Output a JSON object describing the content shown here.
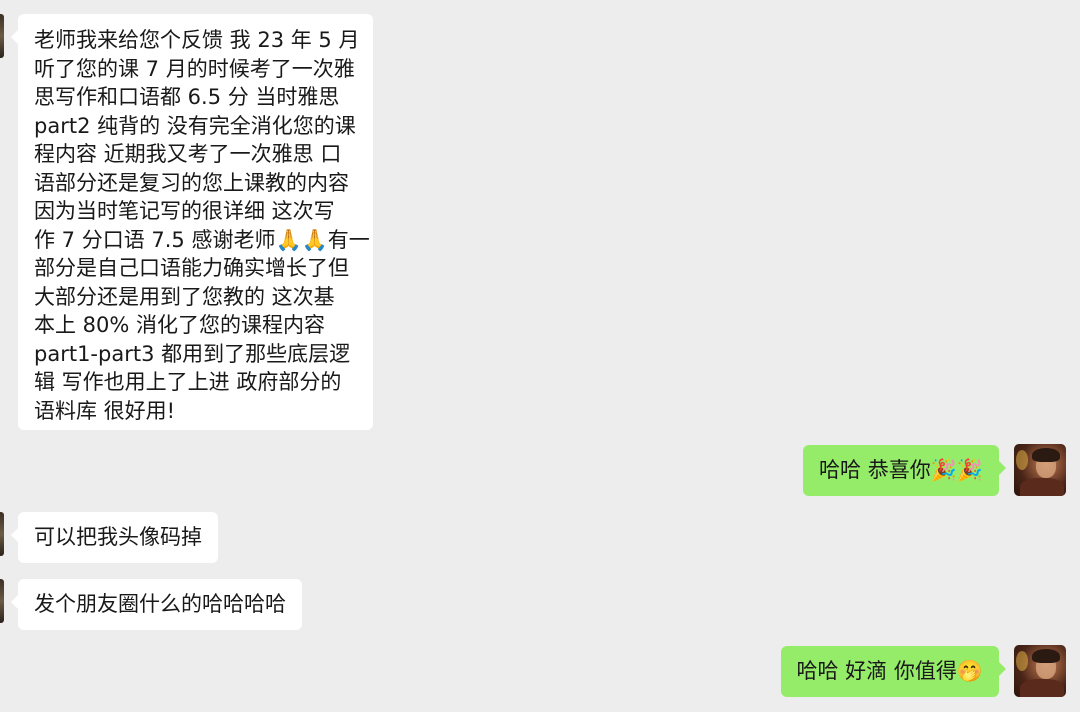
{
  "messages": [
    {
      "side": "left",
      "lines": [
        "老师我来给您个反馈 我 23 年 5 月",
        "听了您的课 7 月的时候考了一次雅",
        "思写作和口语都 6.5 分 当时雅思",
        "part2 纯背的 没有完全消化您的课",
        "程内容 近期我又考了一次雅思 口",
        "语部分还是复习的您上课教的内容",
        "因为当时笔记写的很详细 这次写",
        "作 7 分口语 7.5 感谢老师🙏🙏有一",
        "部分是自己口语能力确实增长了但",
        "大部分还是用到了您教的 这次基",
        "本上 80% 消化了您的课程内容",
        "part1-part3 都用到了那些底层逻",
        "辑 写作也用上了上进 政府部分的",
        "语料库 很好用!"
      ]
    },
    {
      "side": "right",
      "text": "哈哈 恭喜你🎉🎉"
    },
    {
      "side": "left",
      "text": "可以把我头像码掉"
    },
    {
      "side": "left",
      "text": "发个朋友圈什么的哈哈哈哈"
    },
    {
      "side": "right",
      "text": "哈哈 好滴 你值得🤭"
    }
  ],
  "colors": {
    "background": "#ededed",
    "incoming_bubble": "#ffffff",
    "outgoing_bubble": "#95ec69"
  }
}
